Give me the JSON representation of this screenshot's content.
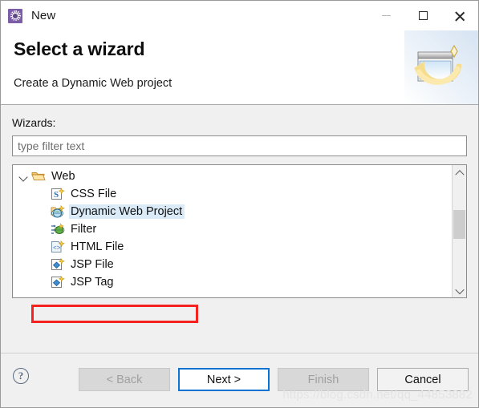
{
  "window": {
    "title": "New",
    "app_icon": "eclipse-new-wizard-icon",
    "controls": {
      "minimize": "minimize-icon",
      "maximize": "maximize-icon",
      "close": "close-icon"
    }
  },
  "header": {
    "title": "Select a wizard",
    "subtitle": "Create a Dynamic Web project",
    "banner_icon": "wizard-banner-icon"
  },
  "body": {
    "wizards_label": "Wizards:",
    "filter": {
      "value": "",
      "placeholder": "type filter text"
    },
    "tree": {
      "root": {
        "label": "Web",
        "icon": "open-folder-icon",
        "expanded": true,
        "expander": "chevron-down-icon"
      },
      "items": [
        {
          "label": "CSS File",
          "icon": "css-file-icon",
          "selected": false
        },
        {
          "label": "Dynamic Web Project",
          "icon": "dynamic-web-project-icon",
          "selected": true
        },
        {
          "label": "Filter",
          "icon": "filter-icon",
          "selected": false
        },
        {
          "label": "HTML File",
          "icon": "html-file-icon",
          "selected": false
        },
        {
          "label": "JSP File",
          "icon": "jsp-file-icon",
          "selected": false
        },
        {
          "label": "JSP Tag",
          "icon": "jsp-tag-icon",
          "selected": false
        }
      ],
      "scrollbar": {
        "up_arrow": "scroll-up-icon",
        "down_arrow": "scroll-down-icon"
      }
    }
  },
  "footer": {
    "help_icon": "help-icon",
    "help_glyph": "?",
    "buttons": {
      "back": "< Back",
      "next": "Next >",
      "finish": "Finish",
      "cancel": "Cancel"
    }
  },
  "watermark": "https://blog.csdn.net/qq_44853882",
  "colors": {
    "selection_highlight": "#daeaf7",
    "focus_border": "#0a73d4",
    "annotation_box": "#f5231f",
    "title_icon": "#7b5ea7"
  }
}
